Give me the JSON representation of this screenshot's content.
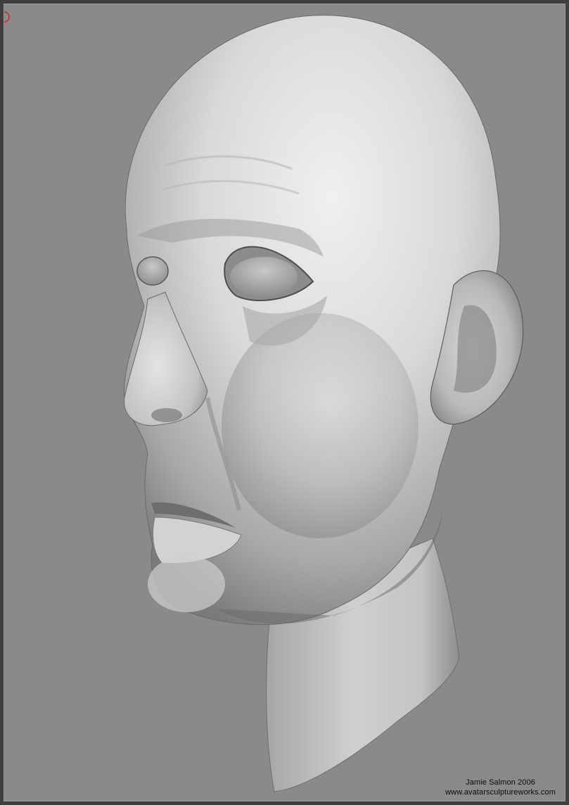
{
  "viewport": {
    "background": "#8a8a8a",
    "frame_color": "#3f3f3f"
  },
  "indicator": {
    "icon": "partial-circle-icon",
    "color": "#cc2222"
  },
  "artwork": {
    "subject": "clay-head-sculpt",
    "clay_light": "#e6e6e6",
    "clay_mid": "#b4b4b4",
    "clay_dark": "#5e5e5e"
  },
  "credits": {
    "author_line": "Jamie Salmon 2006",
    "website": "www.avatarsculptureworks.com"
  }
}
